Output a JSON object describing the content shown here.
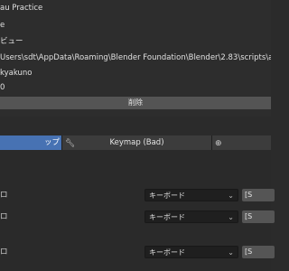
{
  "addon_info": {
    "name": "au Practice",
    "line2": "e",
    "line3": "ビュー",
    "path": "Users\\sdt\\AppData\\Roaming\\Blender Foundation\\Blender\\2.83\\scripts\\addons",
    "author": "kyakuno",
    "version": "0",
    "delete_label": "削除"
  },
  "tabs": {
    "active_label": "ップ",
    "keymap_label": "Keymap (Bad)"
  },
  "settings": {
    "rows": [
      {
        "label": "ロ",
        "dropdown_value": "キーボード",
        "key_label": "[S"
      },
      {
        "label": "ロ",
        "dropdown_value": "キーボード",
        "key_label": "[S"
      },
      {
        "label": "ロ",
        "dropdown_value": "キーボード",
        "key_label": "[S"
      }
    ]
  },
  "icons": {
    "keymap_tab": "wrench-icon",
    "other_tab": "globe-icon",
    "dropdown": "chevron-down-icon"
  }
}
